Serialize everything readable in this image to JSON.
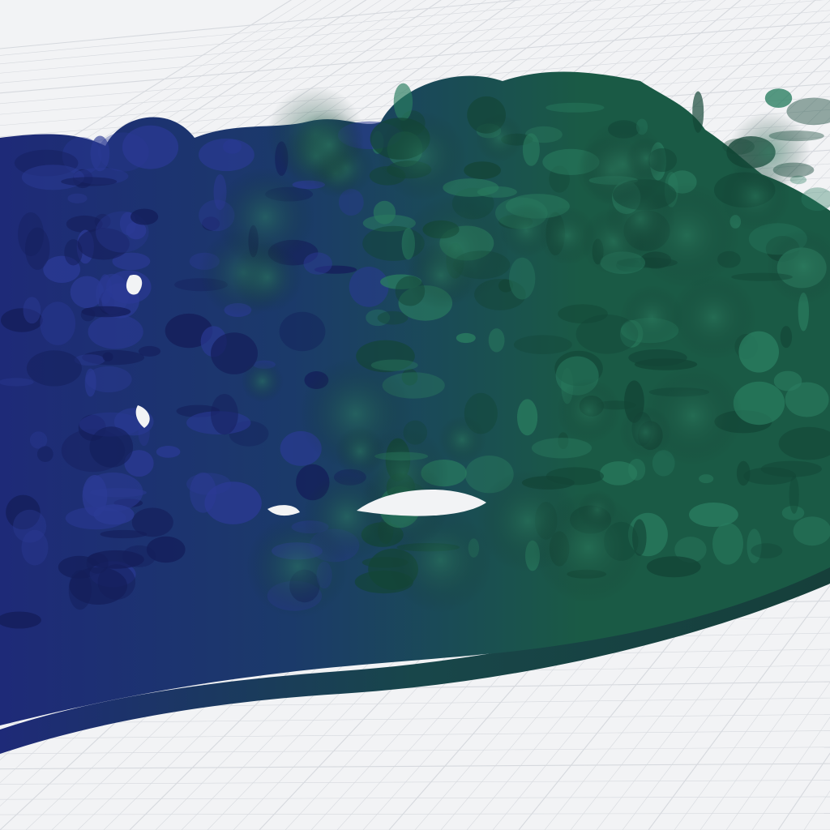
{
  "viewer": {
    "grid": true,
    "background_color": "#f2f3f5",
    "grid_color": "#d6d9de",
    "model": {
      "primary_color": "#1a5a45",
      "shadow_color": "#1e2a78",
      "base_color": "#163f3a"
    }
  }
}
